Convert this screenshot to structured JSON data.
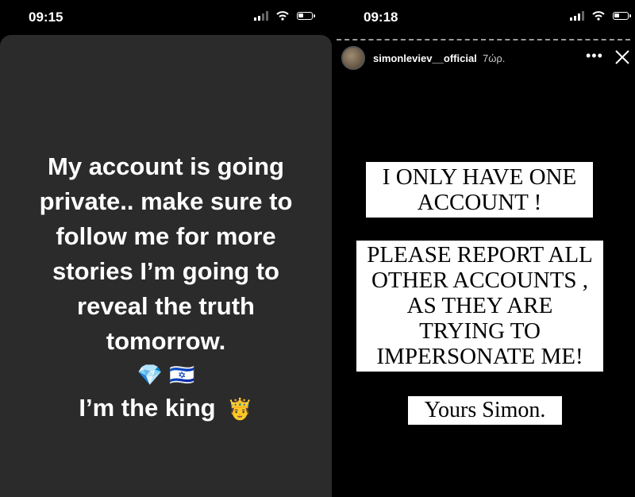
{
  "left": {
    "status_time": "09:15",
    "story_lines": [
      "My account  is going",
      "private.. make sure to",
      "follow me for more",
      "stories I’m going to",
      "reveal the truth",
      "tomorrow."
    ],
    "emoji_diamond": "💎",
    "emoji_flag": "🇮🇱",
    "king_text": "I’m the king",
    "emoji_crown": "🤴",
    "card_color": "#2b2b2b"
  },
  "right": {
    "status_time": "09:18",
    "username": "simonleviev__official",
    "time_ago": "7ώρ.",
    "more_label": "•••",
    "box1_lines": [
      "I ONLY HAVE ONE",
      "ACCOUNT !"
    ],
    "box2_lines": [
      "PLEASE REPORT ALL",
      "OTHER ACCOUNTS ,",
      "AS THEY ARE",
      "TRYING TO",
      "IMPERSONATE ME!"
    ],
    "box3_text": "Yours Simon."
  },
  "icons": [
    "signal-icon",
    "wifi-icon",
    "battery-icon",
    "more-icon",
    "close-icon",
    "avatar"
  ]
}
